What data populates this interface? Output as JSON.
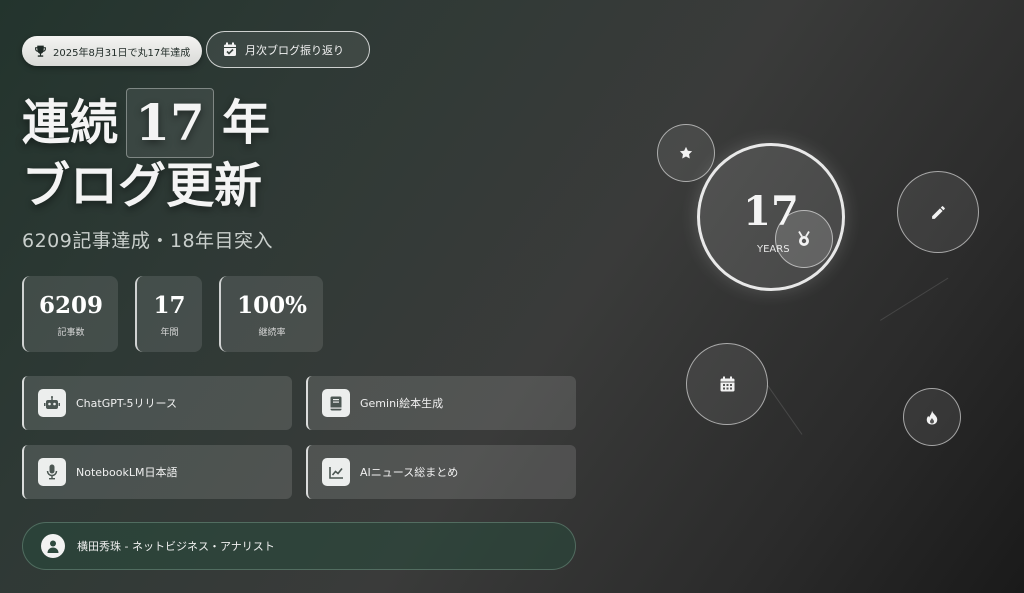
{
  "badge": {
    "achievement_text": "2025年8月31日で丸17年達成",
    "icon": "trophy-icon"
  },
  "review_button": {
    "label": "月次ブログ振り返り",
    "icon": "calendar-check-icon"
  },
  "headline": {
    "prefix": "連続",
    "number": "17",
    "suffix": "年",
    "line2": "ブログ更新"
  },
  "subtitle": "6209記事達成・18年目突入",
  "stats": [
    {
      "value": "6209",
      "label": "記事数"
    },
    {
      "value": "17",
      "label": "年間"
    },
    {
      "value": "100%",
      "label": "継続率"
    }
  ],
  "topics": [
    {
      "label": "ChatGPT-5リリース",
      "icon": "robot-icon"
    },
    {
      "label": "Gemini絵本生成",
      "icon": "book-icon"
    },
    {
      "label": "NotebookLM日本語",
      "icon": "microphone-icon"
    },
    {
      "label": "AIニュース総まとめ",
      "icon": "chart-line-icon"
    }
  ],
  "author": {
    "name": "横田秀珠 - ネットビジネス・アナリスト",
    "icon": "user-icon"
  },
  "visual": {
    "center_number": "17",
    "center_label": "YEARS",
    "orbit_icons": [
      "star-icon",
      "pencil-icon",
      "medal-icon",
      "calendar-icon",
      "fire-icon"
    ]
  },
  "colors": {
    "accent_green": "#284b3c",
    "text": "#ffffff",
    "card_bg": "rgba(255,255,255,0.13)"
  }
}
